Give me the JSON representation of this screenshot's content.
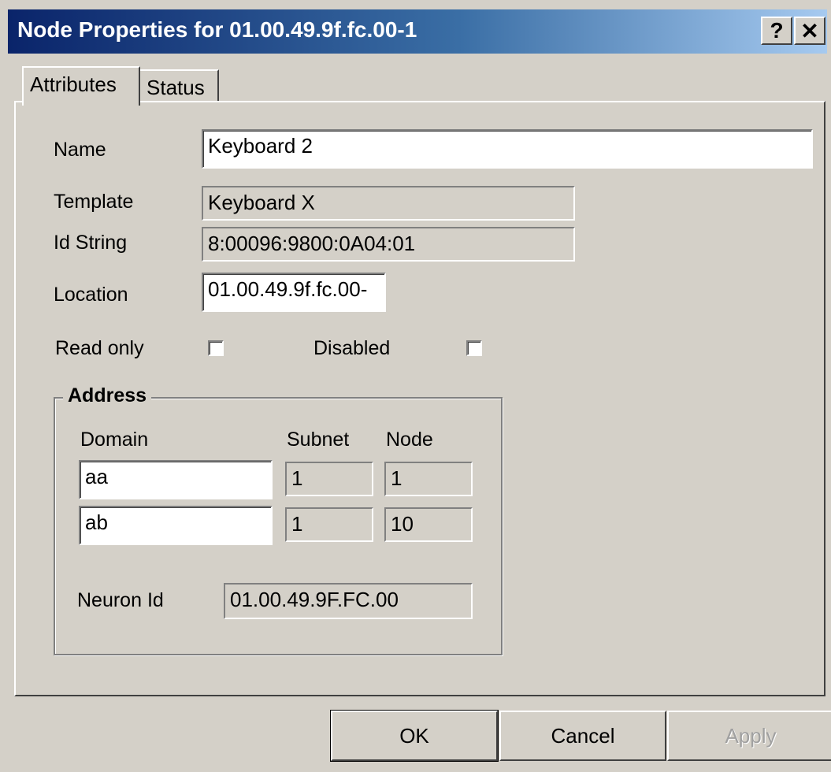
{
  "window": {
    "title": "Node Properties for 01.00.49.9f.fc.00-1",
    "help_glyph": "?",
    "close_glyph": "✕"
  },
  "tabs": [
    {
      "label": "Attributes",
      "active": true
    },
    {
      "label": "Status",
      "active": false
    }
  ],
  "attributes": {
    "name_label": "Name",
    "name_value": "Keyboard 2",
    "template_label": "Template",
    "template_value": "Keyboard X",
    "idstring_label": "Id String",
    "idstring_value": "8:00096:9800:0A04:01",
    "location_label": "Location",
    "location_value": "01.00.49.9f.fc.00-",
    "readonly_label": "Read only",
    "readonly_checked": false,
    "disabled_label": "Disabled",
    "disabled_checked": false
  },
  "address": {
    "group_title": "Address",
    "domain_header": "Domain",
    "subnet_header": "Subnet",
    "node_header": "Node",
    "rows": [
      {
        "domain": "aa",
        "subnet": "1",
        "node": "1"
      },
      {
        "domain": "ab",
        "subnet": "1",
        "node": "10"
      }
    ],
    "neuron_label": "Neuron Id",
    "neuron_value": "01.00.49.9F.FC.00"
  },
  "buttons": {
    "ok": "OK",
    "cancel": "Cancel",
    "apply": "Apply"
  }
}
